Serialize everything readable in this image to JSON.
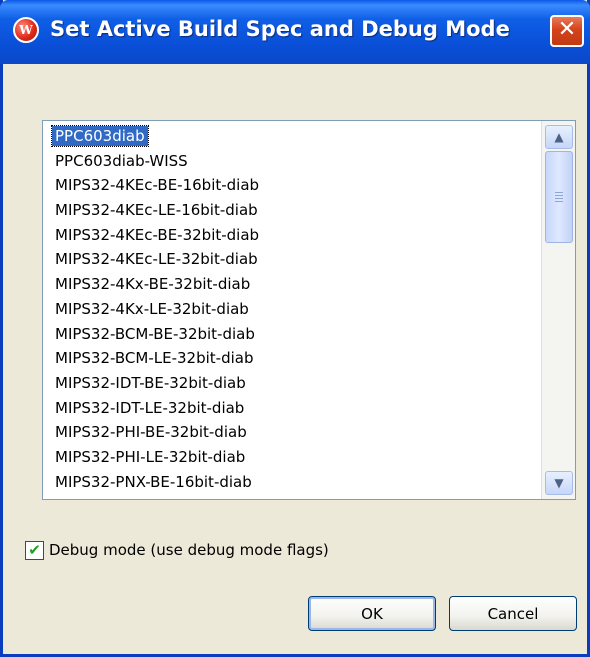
{
  "window": {
    "title": "Set Active Build Spec and Debug Mode",
    "icon_letter": "W",
    "close_glyph": "✕"
  },
  "build_specs": {
    "selected_index": 0,
    "items": [
      "PPC603diab",
      "PPC603diab-WISS",
      "MIPS32-4KEc-BE-16bit-diab",
      "MIPS32-4KEc-LE-16bit-diab",
      "MIPS32-4KEc-BE-32bit-diab",
      "MIPS32-4KEc-LE-32bit-diab",
      "MIPS32-4Kx-BE-32bit-diab",
      "MIPS32-4Kx-LE-32bit-diab",
      "MIPS32-BCM-BE-32bit-diab",
      "MIPS32-BCM-LE-32bit-diab",
      "MIPS32-IDT-BE-32bit-diab",
      "MIPS32-IDT-LE-32bit-diab",
      "MIPS32-PHI-BE-32bit-diab",
      "MIPS32-PHI-LE-32bit-diab",
      "MIPS32-PNX-BE-16bit-diab"
    ]
  },
  "debug_mode": {
    "label": "Debug mode (use debug mode flags)",
    "checked": true,
    "check_glyph": "✔"
  },
  "buttons": {
    "ok_label": "OK",
    "cancel_label": "Cancel"
  },
  "colors": {
    "titlebar": "#0a4fd8",
    "selection": "#316ac5",
    "dialog_bg": "#ece9d8"
  }
}
